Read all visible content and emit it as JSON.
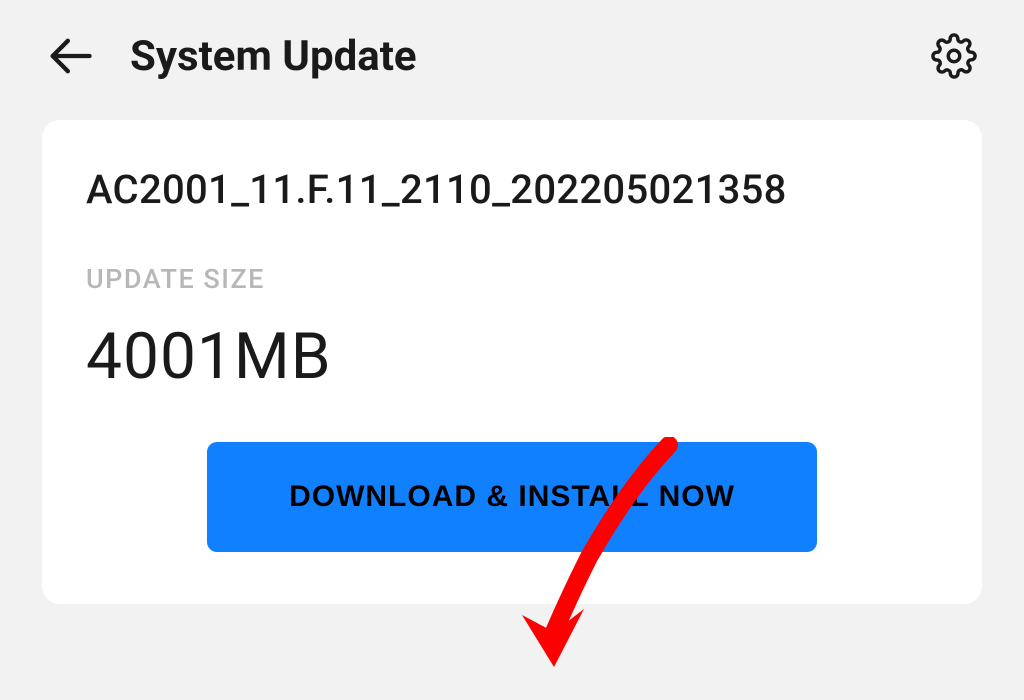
{
  "header": {
    "title": "System Update"
  },
  "update": {
    "version": "AC2001_11.F.11_2110_202205021358",
    "size_label": "UPDATE SIZE",
    "size_value": "4001MB",
    "download_label": "DOWNLOAD & INSTALL NOW"
  },
  "colors": {
    "accent": "#1180ff",
    "text": "#1a1a1a",
    "muted": "#b7b7b7",
    "annotation": "#ff0000"
  }
}
